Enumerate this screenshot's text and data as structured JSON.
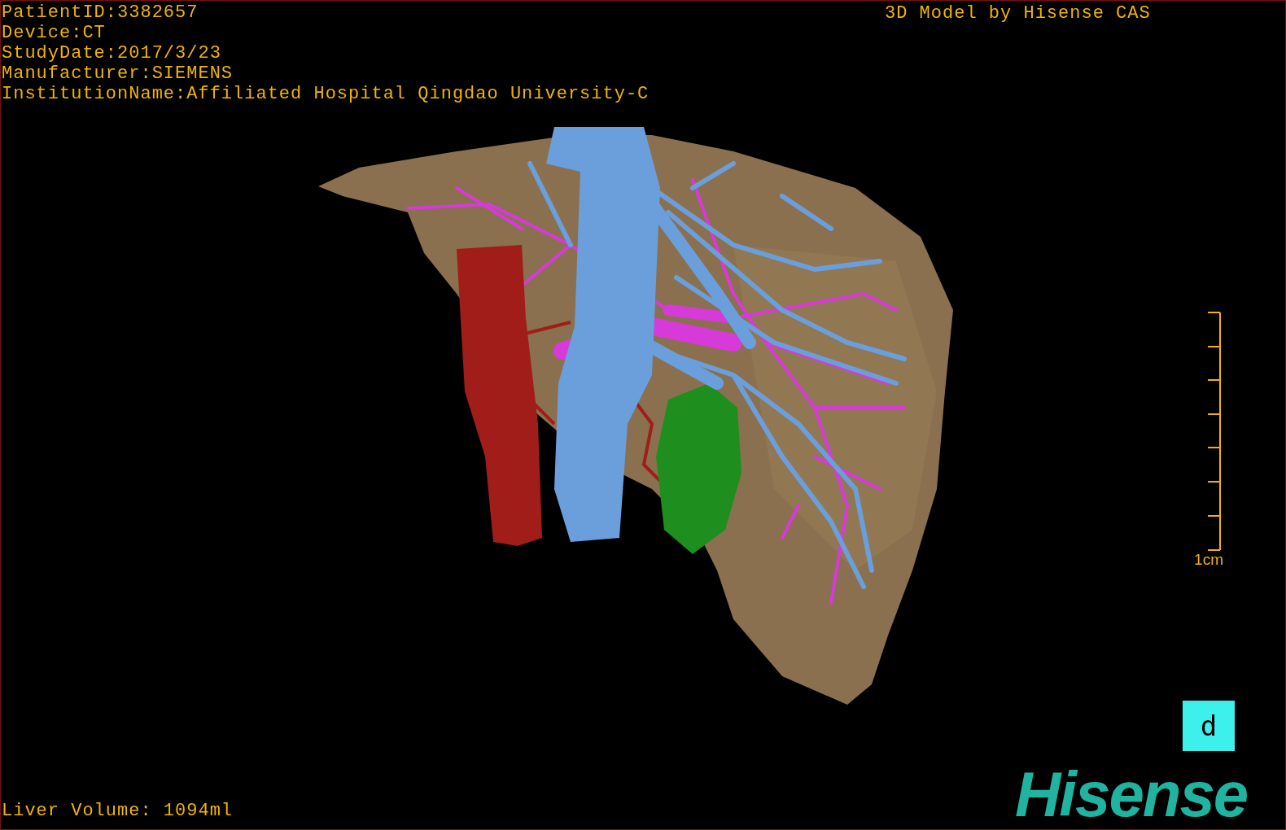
{
  "info_lines": [
    {
      "label": "PatientID:",
      "value": "3382657"
    },
    {
      "label": "Device:",
      "value": "CT"
    },
    {
      "label": "StudyDate:",
      "value": "2017/3/23"
    },
    {
      "label": "Manufacturer:",
      "value": "SIEMENS"
    },
    {
      "label": "InstitutionName:",
      "value": "Affiliated Hospital Qingdao University-C"
    }
  ],
  "credit": "3D Model by Hisense CAS",
  "scale_bar": {
    "label": "1cm"
  },
  "view_button": {
    "label": "d"
  },
  "liver_volume": "Liver Volume: 1094ml",
  "logo": "Hisense"
}
